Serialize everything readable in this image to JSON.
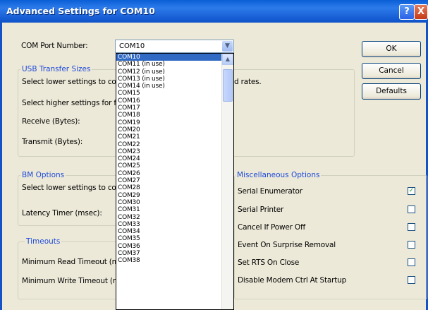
{
  "window": {
    "title": "Advanced Settings for COM10",
    "help_label": "?",
    "close_label": "X"
  },
  "port": {
    "label": "COM Port Number:",
    "selected": "COM10",
    "options": [
      "COM10",
      "COM11 (in use)",
      "COM12 (in use)",
      "COM13 (in use)",
      "COM14 (in use)",
      "COM15",
      "COM16",
      "COM17",
      "COM18",
      "COM19",
      "COM20",
      "COM21",
      "COM22",
      "COM23",
      "COM24",
      "COM25",
      "COM26",
      "COM27",
      "COM28",
      "COM29",
      "COM30",
      "COM31",
      "COM32",
      "COM33",
      "COM34",
      "COM35",
      "COM36",
      "COM37",
      "COM38"
    ]
  },
  "buttons": {
    "ok": "OK",
    "cancel": "Cancel",
    "defaults": "Defaults"
  },
  "usb": {
    "title": "USB Transfer Sizes",
    "lower_text": "Select lower settings to corre",
    "lower_tail": "d rates.",
    "higher_text": "Select higher settings for fas",
    "receive_label": "Receive (Bytes):",
    "transmit_label": "Transmit (Bytes):"
  },
  "bm": {
    "title": "BM Options",
    "lower_text": "Select lower settings to corre",
    "latency_label": "Latency Timer (msec):"
  },
  "timeouts": {
    "title": "Timeouts",
    "read_label": "Minimum Read Timeout (msec",
    "write_label": "Minimum Write Timeout (mse"
  },
  "misc": {
    "title": "Miscellaneous Options",
    "options": [
      {
        "label": "Serial Enumerator",
        "checked": true
      },
      {
        "label": "Serial Printer",
        "checked": false
      },
      {
        "label": "Cancel If Power Off",
        "checked": false
      },
      {
        "label": "Event On Surprise Removal",
        "checked": false
      },
      {
        "label": "Set RTS On Close",
        "checked": false
      },
      {
        "label": "Disable Modem Ctrl At Startup",
        "checked": false
      }
    ]
  }
}
